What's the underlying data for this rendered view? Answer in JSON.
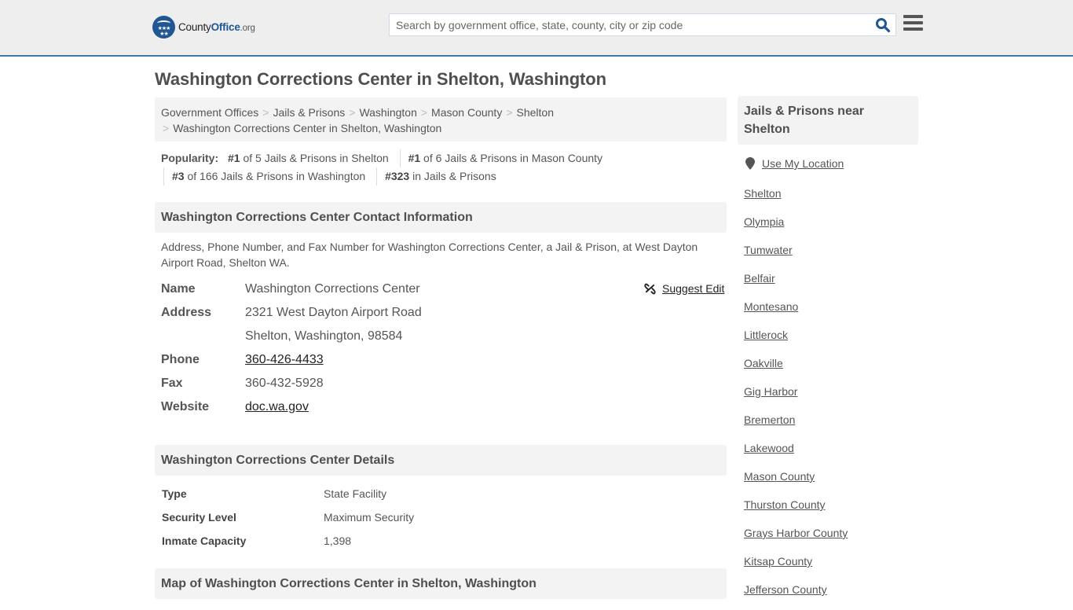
{
  "header": {
    "logo": {
      "part1": "County",
      "part2": "Office",
      "part3": ".org"
    },
    "search": {
      "placeholder": "Search by government office, state, county, city or zip code",
      "value": ""
    },
    "icons": {
      "logo": "eagle-stars-badge-icon",
      "search": "search-icon",
      "menu": "hamburger-menu-icon"
    }
  },
  "page_title": "Washington Corrections Center in Shelton, Washington",
  "breadcrumb": [
    "Government Offices",
    "Jails & Prisons",
    "Washington",
    "Mason County",
    "Shelton",
    "Washington Corrections Center in Shelton, Washington"
  ],
  "popularity": {
    "label": "Popularity:",
    "items": [
      {
        "rank": "#1",
        "text": " of 5 Jails & Prisons in Shelton"
      },
      {
        "rank": "#1",
        "text": " of 6 Jails & Prisons in Mason County"
      },
      {
        "rank": "#3",
        "text": " of 166 Jails & Prisons in Washington"
      },
      {
        "rank": "#323",
        "text": " in Jails & Prisons"
      }
    ]
  },
  "contact": {
    "heading": "Washington Corrections Center Contact Information",
    "description": "Address, Phone Number, and Fax Number for Washington Corrections Center, a Jail & Prison, at West Dayton Airport Road, Shelton WA.",
    "suggest_edit": "Suggest Edit",
    "fields": {
      "name_label": "Name",
      "name": "Washington Corrections Center",
      "address_label": "Address",
      "address1": "2321 West Dayton Airport Road",
      "address2": "Shelton, Washington, 98584",
      "phone_label": "Phone",
      "phone": "360-426-4433",
      "fax_label": "Fax",
      "fax": "360-432-5928",
      "website_label": "Website",
      "website": "doc.wa.gov"
    }
  },
  "details": {
    "heading": "Washington Corrections Center Details",
    "rows": [
      {
        "label": "Type",
        "value": "State Facility"
      },
      {
        "label": "Security Level",
        "value": "Maximum Security"
      },
      {
        "label": "Inmate Capacity",
        "value": "1,398"
      }
    ]
  },
  "map": {
    "heading": "Map of Washington Corrections Center in Shelton, Washington"
  },
  "sidebar": {
    "heading": "Jails & Prisons near Shelton",
    "use_location": "Use My Location",
    "links": [
      "Shelton",
      "Olympia",
      "Tumwater",
      "Belfair",
      "Montesano",
      "Littlerock",
      "Oakville",
      "Gig Harbor",
      "Bremerton",
      "Lakewood",
      "Mason County",
      "Thurston County",
      "Grays Harbor County",
      "Kitsap County",
      "Jefferson County"
    ]
  },
  "colors": {
    "brand": "#1f5693",
    "header_border": "#3f79a8",
    "header_bg": "#eeeeee",
    "panel_bg": "#f3f3f3"
  }
}
